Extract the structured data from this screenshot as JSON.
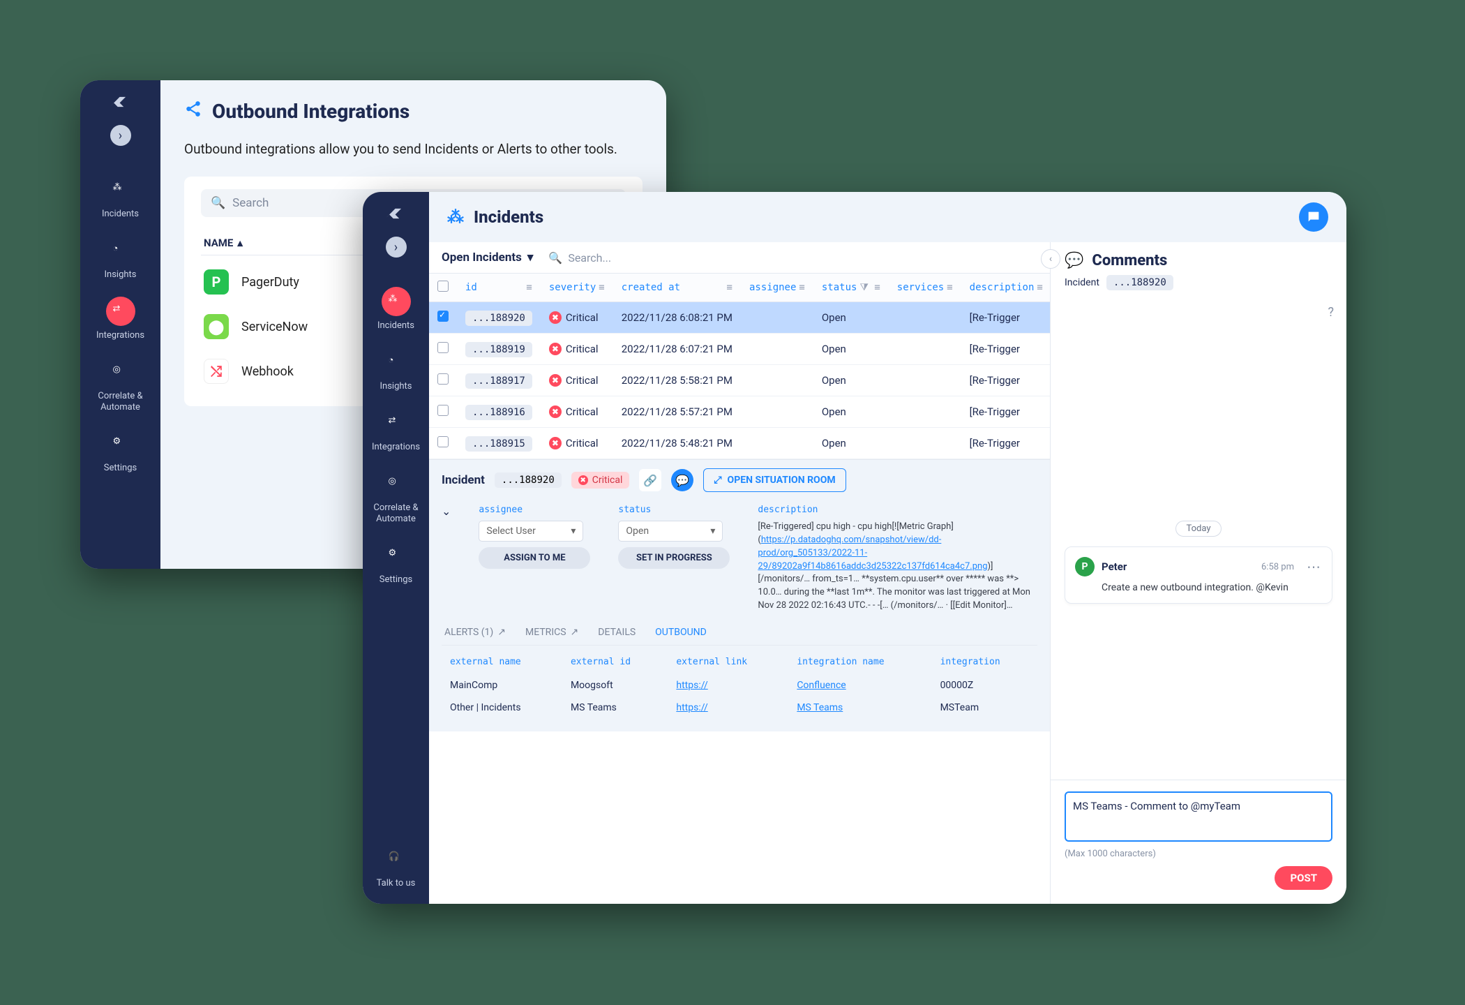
{
  "w1": {
    "title": "Outbound Integrations",
    "subtitle": "Outbound integrations allow you to send Incidents or Alerts to other tools.",
    "search_placeholder": "Search",
    "name_header": "NAME",
    "integrations": [
      {
        "name": "PagerDuty",
        "badge": "P",
        "bg": "#25c151"
      },
      {
        "name": "ServiceNow",
        "badge": "⬤",
        "bg": "#7ad94a"
      },
      {
        "name": "Webhook",
        "badge": "⤭",
        "bg": "#ffffff"
      }
    ],
    "nav": {
      "incidents": "Incidents",
      "insights": "Insights",
      "integrations": "Integrations",
      "correlate": "Correlate & Automate",
      "settings": "Settings"
    }
  },
  "w2": {
    "title": "Incidents",
    "filter": "Open Incidents",
    "search_placeholder": "Search...",
    "columns": [
      "id",
      "severity",
      "created at",
      "assignee",
      "status",
      "services",
      "description"
    ],
    "rows": [
      {
        "id": "...188920",
        "selected": true,
        "severity": "Critical",
        "created_at": "2022/11/28 6:08:21 PM",
        "assignee": "",
        "status": "Open",
        "services": "",
        "description": "[Re-Trigger"
      },
      {
        "id": "...188919",
        "selected": false,
        "severity": "Critical",
        "created_at": "2022/11/28 6:07:21 PM",
        "assignee": "",
        "status": "Open",
        "services": "",
        "description": "[Re-Trigger"
      },
      {
        "id": "...188917",
        "selected": false,
        "severity": "Critical",
        "created_at": "2022/11/28 5:58:21 PM",
        "assignee": "",
        "status": "Open",
        "services": "",
        "description": "[Re-Trigger"
      },
      {
        "id": "...188916",
        "selected": false,
        "severity": "Critical",
        "created_at": "2022/11/28 5:57:21 PM",
        "assignee": "",
        "status": "Open",
        "services": "",
        "description": "[Re-Trigger"
      },
      {
        "id": "...188915",
        "selected": false,
        "severity": "Critical",
        "created_at": "2022/11/28 5:48:21 PM",
        "assignee": "",
        "status": "Open",
        "services": "",
        "description": "[Re-Trigger"
      }
    ],
    "detail": {
      "label": "Incident",
      "id": "...188920",
      "severity": "Critical",
      "situation_room": "OPEN SITUATION ROOM",
      "assignee_label": "assignee",
      "assignee_placeholder": "Select User",
      "assign_to_me": "ASSIGN TO ME",
      "status_label": "status",
      "status_value": "Open",
      "set_in_progress": "SET IN PROGRESS",
      "description_label": "description",
      "description_text": "[Re-Triggered] cpu high - cpu high[![Metric Graph](",
      "description_link1": "https://p.datadoghq.com/snapshot/view/dd-prod/org_505133/2022-11-29/89202a9f14b8616addc3d25322c137fd614ca4c7.png",
      "description_text2": ")][/monitors/… from_ts=1…  **system.cpu.user** over ***** was **> 10.0… during the **last 1m**. The monitor was last triggered at Mon Nov 28 2022 02:16:43 UTC.- - -[… (/monitors/…  · [[Edit Monitor]…"
    },
    "tabs": {
      "alerts": "ALERTS (1)",
      "metrics": "METRICS",
      "details": "DETAILS",
      "outbound": "OUTBOUND"
    },
    "outbound_cols": [
      "external name",
      "external id",
      "external link",
      "integration name",
      "integration"
    ],
    "outbound_rows": [
      {
        "external_name": "MainComp",
        "external_id": "Moogsoft",
        "external_link": "https://",
        "integration_name": "Confluence",
        "integration": "00000Z"
      },
      {
        "external_name": "Other | Incidents",
        "external_id": "MS Teams",
        "external_link": "https://",
        "integration_name": "MS Teams",
        "integration": "MSTeam"
      }
    ],
    "comments": {
      "title": "Comments",
      "crumb_label": "Incident",
      "crumb_id": "...188920",
      "date_divider": "Today",
      "items": [
        {
          "avatar": "P",
          "name": "Peter",
          "time": "6:58 pm",
          "text": "Create a new outbound integration. @Kevin"
        }
      ],
      "input_value": "MS Teams - Comment to @myTeam",
      "hint": "(Max 1000 characters)",
      "post": "POST"
    },
    "nav": {
      "incidents": "Incidents",
      "insights": "Insights",
      "integrations": "Integrations",
      "correlate": "Correlate & Automate",
      "settings": "Settings",
      "talk": "Talk to us"
    }
  }
}
